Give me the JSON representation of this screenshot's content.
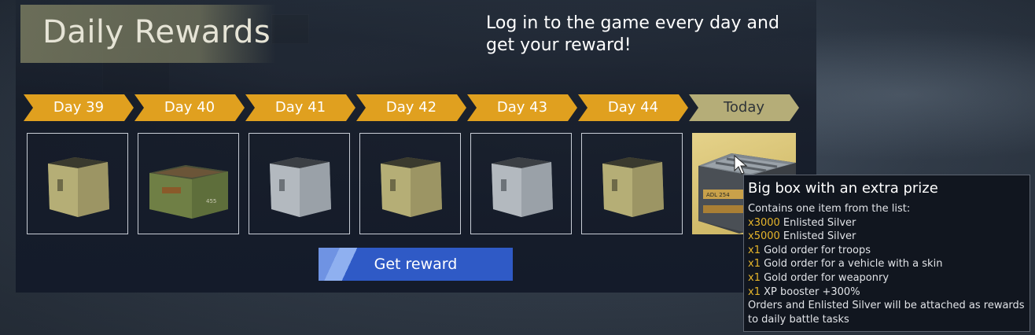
{
  "header": {
    "title": "Daily Rewards",
    "headline": "Log in to the game every day and get your reward!"
  },
  "days": [
    {
      "label": "Day 39",
      "box": "olive-open-box"
    },
    {
      "label": "Day 40",
      "box": "green-ammo-crate"
    },
    {
      "label": "Day 41",
      "box": "steel-open-box"
    },
    {
      "label": "Day 42",
      "box": "olive-open-box"
    },
    {
      "label": "Day 43",
      "box": "steel-open-box"
    },
    {
      "label": "Day 44",
      "box": "olive-open-box"
    },
    {
      "label": "Today",
      "box": "big-prize-box",
      "crate_marking": "ADL 254"
    }
  ],
  "button": {
    "label": "Get reward"
  },
  "tooltip": {
    "title": "Big box with an extra prize",
    "intro": "Contains one item from the list:",
    "items": [
      {
        "qty": "x3000",
        "text": "Enlisted Silver"
      },
      {
        "qty": "x5000",
        "text": "Enlisted Silver"
      },
      {
        "qty": "x1",
        "text": "Gold order for troops"
      },
      {
        "qty": "x1",
        "text": "Gold order for a vehicle with a skin"
      },
      {
        "qty": "x1",
        "text": "Gold order for weaponry"
      },
      {
        "qty": "x1",
        "text": "XP booster +300%"
      }
    ],
    "note": "Orders and Enlisted Silver will be attached as rewards to daily battle tasks"
  },
  "colors": {
    "day_ribbon": "#e0a01f",
    "today_ribbon": "#b5ad78",
    "button": "#2f5ac6",
    "quantity_text": "#e6b52b"
  }
}
